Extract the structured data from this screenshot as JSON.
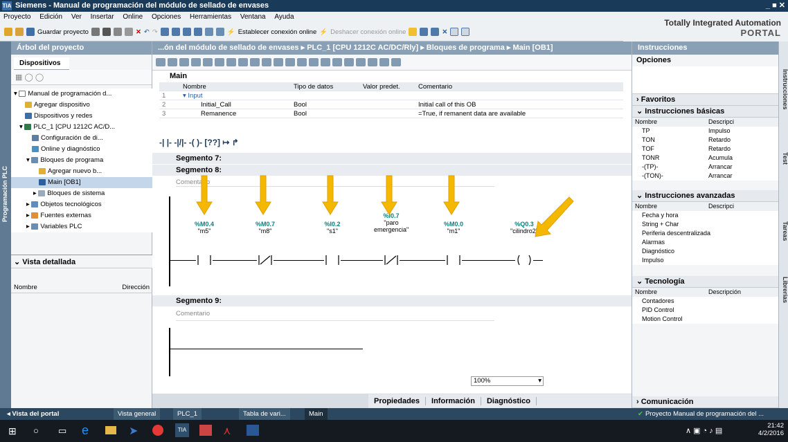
{
  "title": {
    "text": "Siemens  -  Manual de programación del módulo de sellado de envases",
    "app_icon": "TIA",
    "window_controls": "_ ■ ✕"
  },
  "menu": [
    "Proyecto",
    "Edición",
    "Ver",
    "Insertar",
    "Online",
    "Opciones",
    "Herramientas",
    "Ventana",
    "Ayuda"
  ],
  "toolbar": {
    "save_label": "Guardar proyecto",
    "connect_label": "Establecer conexión online",
    "disconnect_label": "Deshacer conexión online"
  },
  "brand": {
    "line1": "Totally Integrated Automation",
    "line2": "PORTAL"
  },
  "left": {
    "vtab": "Programación PLC",
    "header": "Árbol del proyecto",
    "tab": "Dispositivos",
    "tree": [
      {
        "label": "Manual de programación d..."
      },
      {
        "label": "Agregar dispositivo"
      },
      {
        "label": "Dispositivos y redes"
      },
      {
        "label": "PLC_1 [CPU 1212C AC/D..."
      },
      {
        "label": "Configuración de di..."
      },
      {
        "label": "Online y diagnóstico"
      },
      {
        "label": "Bloques de programa"
      },
      {
        "label": "Agregar nuevo b..."
      },
      {
        "label": "Main [OB1]"
      },
      {
        "label": "Bloques de sistema"
      },
      {
        "label": "Objetos tecnológicos"
      },
      {
        "label": "Fuentes externas"
      },
      {
        "label": "Variables PLC"
      }
    ],
    "detail_header": "Vista detallada",
    "detail_col_name": "Nombre",
    "detail_col_dir": "Dirección"
  },
  "editor": {
    "breadcrumb": "...ón del módulo de sellado de envases ▸ PLC_1 [CPU 1212C AC/DC/Rly] ▸ Bloques de programa ▸ Main [OB1]",
    "block": "Main",
    "columns": [
      "Nombre",
      "Tipo de datos",
      "Valor predet.",
      "Comentario"
    ],
    "rows": [
      {
        "num": "1",
        "name": "▾ Input",
        "type": "",
        "def": "",
        "comment": ""
      },
      {
        "num": "2",
        "name": "Initial_Call",
        "type": "Bool",
        "def": "",
        "comment": "Initial call of this OB"
      },
      {
        "num": "3",
        "name": "Remanence",
        "type": "Bool",
        "def": "",
        "comment": "=True, if remanent data are available"
      }
    ],
    "ladder_tools": "-| |-  -|/|-  -( )-  [??]  ↦  ↱",
    "seg7": "Segmento 7:",
    "seg8": "Segmento 8:",
    "seg8_comment": "Comentario",
    "seg9": "Segmento 9:",
    "seg9_comment": "Comentario",
    "zoom": "100%",
    "contacts": [
      {
        "addr": "%M0.4",
        "name": "\"m5\"",
        "kind": "NO"
      },
      {
        "addr": "%M0.7",
        "name": "\"m8\"",
        "kind": "NC"
      },
      {
        "addr": "%I0.2",
        "name": "\"s1\"",
        "kind": "NO"
      },
      {
        "addr": "%I0.7",
        "name": "\"paro emergencia\"",
        "kind": "NC"
      },
      {
        "addr": "%M0.0",
        "name": "\"m1\"",
        "kind": "NO"
      },
      {
        "addr": "%Q0.3",
        "name": "\"cilindro2\"",
        "kind": "COIL"
      }
    ]
  },
  "right": {
    "header": "Instrucciones",
    "options": "Opciones",
    "favoritos": "Favoritos",
    "basicas": "Instrucciones básicas",
    "col_name": "Nombre",
    "col_desc": "Descripci",
    "basic_items": [
      {
        "n": "TP",
        "d": "Impulso"
      },
      {
        "n": "TON",
        "d": "Retardo"
      },
      {
        "n": "TOF",
        "d": "Retardo"
      },
      {
        "n": "TONR",
        "d": "Acumula"
      },
      {
        "n": "-(TP)-",
        "d": "Arrancar"
      },
      {
        "n": "-(TON)-",
        "d": "Arrancar"
      }
    ],
    "avanzadas": "Instrucciones avanzadas",
    "adv_items": [
      "Fecha y hora",
      "String + Char",
      "Periferia descentralizada",
      "Alarmas",
      "Diagnóstico",
      "Impulso"
    ],
    "tecnologia": "Tecnología",
    "col_desc2": "Descripción",
    "tec_items": [
      "Contadores",
      "PID Control",
      "Motion Control"
    ],
    "comunicacion": "Comunicación",
    "vtabs": [
      "Instrucciones",
      "Test",
      "Tareas",
      "Librerías"
    ]
  },
  "inspector": [
    "Propiedades",
    "Información",
    "Diagnóstico"
  ],
  "portal": {
    "back": "◂  Vista del portal",
    "tabs": [
      "Vista general",
      "PLC_1",
      "Tabla de vari...",
      "Main"
    ],
    "status": "Proyecto Manual de programación del ..."
  },
  "taskbar": {
    "time": "21:42",
    "date": "4/2/2016"
  },
  "colors": {
    "accent": "#0a8080",
    "arrow": "#f5b800",
    "header": "#8aa1b5"
  }
}
